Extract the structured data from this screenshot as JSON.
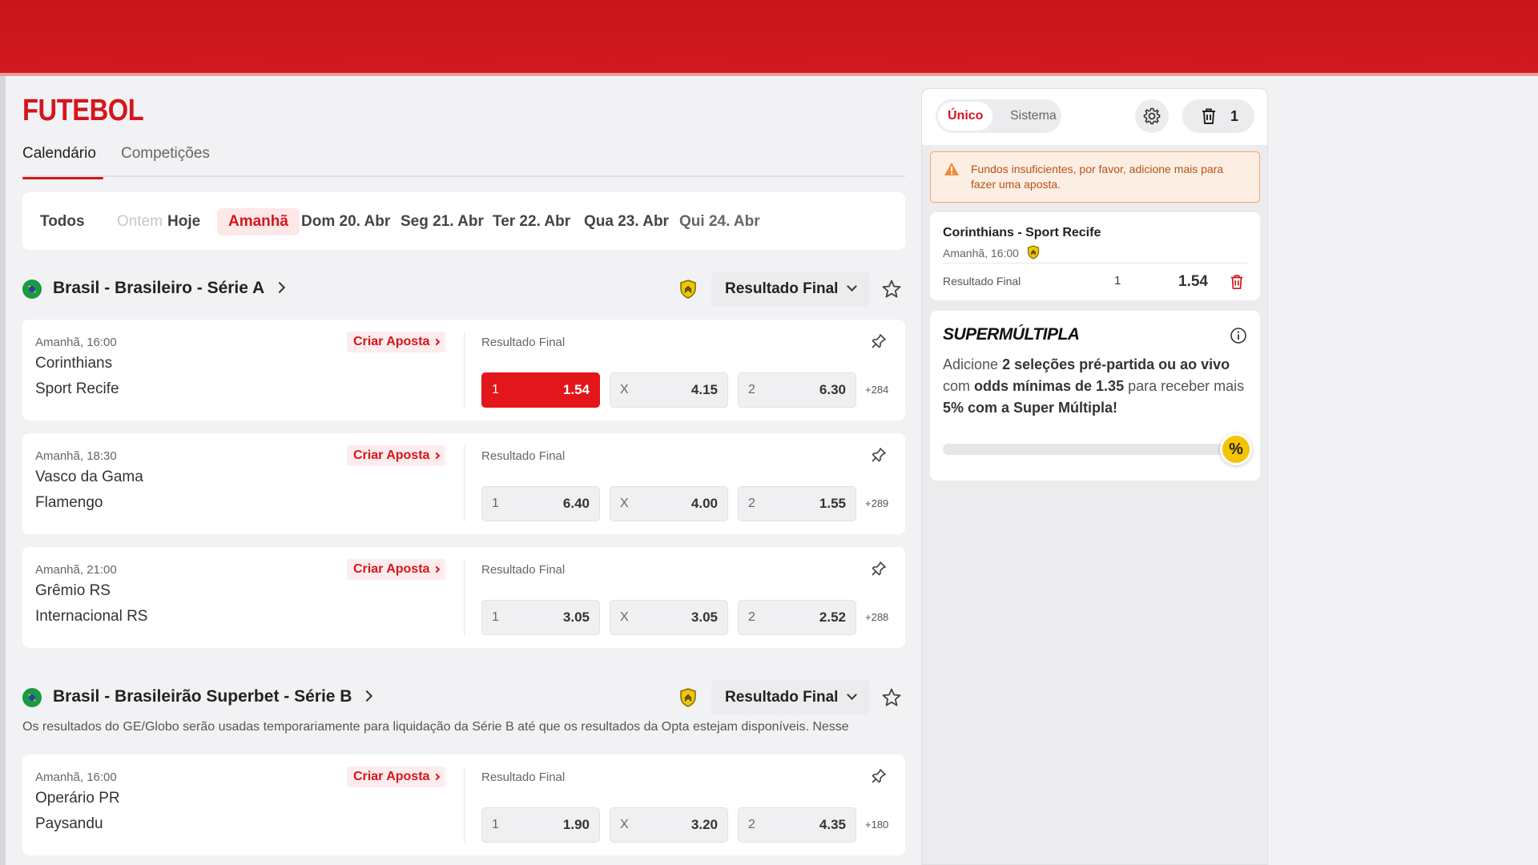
{
  "page": {
    "title": "FUTEBOL"
  },
  "tabs": [
    {
      "label": "Calendário"
    },
    {
      "label": "Competições"
    }
  ],
  "dates": [
    {
      "label": "Todos"
    },
    {
      "label": "Ontem"
    },
    {
      "label": "Hoje"
    },
    {
      "label": "Amanhã"
    },
    {
      "label": "Dom 20. Abr"
    },
    {
      "label": "Seg 21. Abr"
    },
    {
      "label": "Ter 22. Abr"
    },
    {
      "label": "Qua 23. Abr"
    },
    {
      "label": "Qui 24. Abr"
    }
  ],
  "leagues": [
    {
      "name": "Brasil - Brasileiro - Série A",
      "market": "Resultado Final",
      "matches": [
        {
          "time": "Amanhã, 16:00",
          "home": "Corinthians",
          "away": "Sport Recife",
          "criar": "Criar Aposta",
          "market": "Resultado Final",
          "odds": [
            {
              "label": "1",
              "value": "1.54"
            },
            {
              "label": "X",
              "value": "4.15"
            },
            {
              "label": "2",
              "value": "6.30"
            }
          ],
          "more": "+284"
        },
        {
          "time": "Amanhã, 18:30",
          "home": "Vasco da Gama",
          "away": "Flamengo",
          "criar": "Criar Aposta",
          "market": "Resultado Final",
          "odds": [
            {
              "label": "1",
              "value": "6.40"
            },
            {
              "label": "X",
              "value": "4.00"
            },
            {
              "label": "2",
              "value": "1.55"
            }
          ],
          "more": "+289"
        },
        {
          "time": "Amanhã, 21:00",
          "home": "Grêmio RS",
          "away": "Internacional RS",
          "criar": "Criar Aposta",
          "market": "Resultado Final",
          "odds": [
            {
              "label": "1",
              "value": "3.05"
            },
            {
              "label": "X",
              "value": "3.05"
            },
            {
              "label": "2",
              "value": "2.52"
            }
          ],
          "more": "+288"
        }
      ]
    },
    {
      "name": "Brasil - Brasileirão Superbet - Série B",
      "market": "Resultado Final",
      "note": "Os resultados do GE/Globo serão usadas temporariamente para liquidação da Série B até que os resultados da Opta estejam disponíveis. Nesse",
      "matches": [
        {
          "time": "Amanhã, 16:00",
          "home": "Operário PR",
          "away": "Paysandu",
          "criar": "Criar Aposta",
          "market": "Resultado Final",
          "odds": [
            {
              "label": "1",
              "value": "1.90"
            },
            {
              "label": "X",
              "value": "3.20"
            },
            {
              "label": "2",
              "value": "4.35"
            }
          ],
          "more": "+180"
        }
      ]
    }
  ],
  "betslip": {
    "seg_single": "Único",
    "seg_system": "Sistema",
    "count": "1",
    "warning": "Fundos insuficientes, por favor, adicione mais para fazer uma aposta.",
    "bet": {
      "home": "Corinthians",
      "away": "Sport Recife",
      "separator": " - ",
      "time": "Amanhã, 16:00",
      "market": "Resultado Final",
      "selection": "1",
      "odd": "1.54"
    },
    "super": {
      "title": "SUPERMÚLTIPLA",
      "t1": "Adicione ",
      "b1": "2 seleções pré-partida ou ao vivo",
      "t2": " com ",
      "b2": "odds mínimas de 1.35",
      "t3": " para receber mais ",
      "b3": "5% com a Super Múltipla!",
      "badge": "%",
      "progress": 0
    }
  },
  "colors": {
    "brand": "#d4161c",
    "accent_bg": "#fde8e8",
    "warning": "#f3a36b",
    "badge": "#f4c400"
  }
}
